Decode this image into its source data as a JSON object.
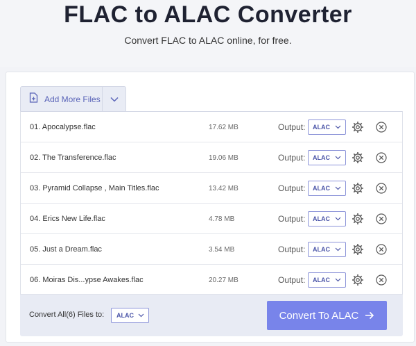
{
  "header": {
    "title": "FLAC to ALAC Converter",
    "subtitle": "Convert FLAC to ALAC online, for free."
  },
  "toolbar": {
    "add_files_label": "Add More Files",
    "add_files_icon": "file-plus-icon",
    "dropdown_icon": "chevron-down-icon"
  },
  "files": [
    {
      "name": "01. Apocalypse.flac",
      "size": "17.62 MB",
      "output_label": "Output:",
      "format": "ALAC"
    },
    {
      "name": "02. The Transference.flac",
      "size": "19.06 MB",
      "output_label": "Output:",
      "format": "ALAC"
    },
    {
      "name": "03. Pyramid Collapse , Main Titles.flac",
      "size": "13.42 MB",
      "output_label": "Output:",
      "format": "ALAC"
    },
    {
      "name": "04. Erics New Life.flac",
      "size": "4.78 MB",
      "output_label": "Output:",
      "format": "ALAC"
    },
    {
      "name": "05. Just a Dream.flac",
      "size": "3.54 MB",
      "output_label": "Output:",
      "format": "ALAC"
    },
    {
      "name": "06. Moiras Dis...ypse Awakes.flac",
      "size": "20.27 MB",
      "output_label": "Output:",
      "format": "ALAC"
    }
  ],
  "footer": {
    "convert_all_label": "Convert All(6) Files to:",
    "convert_all_format": "ALAC",
    "convert_button_label": "Convert To ALAC"
  },
  "colors": {
    "accent": "#7884ea",
    "select_border": "#8b93d8",
    "title": "#1f2232"
  }
}
